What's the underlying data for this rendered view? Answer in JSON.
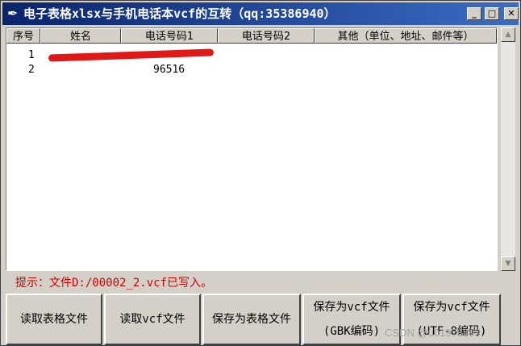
{
  "window": {
    "title": "电子表格xlsx与手机电话本vcf的互转（qq:35386940）",
    "controls": {
      "minimize": "_",
      "maximize": "□",
      "close": "✕"
    }
  },
  "table": {
    "columns": [
      "序号",
      "姓名",
      "电话号码1",
      "电话号码2",
      "其他（单位、地址、邮件等）"
    ],
    "rows": [
      {
        "index": "1",
        "name": "",
        "phone1": "",
        "phone2": "",
        "other": ""
      },
      {
        "index": "2",
        "name": "",
        "phone1": "96516",
        "phone2": "",
        "other": ""
      }
    ]
  },
  "status": {
    "message": "提示：文件D:/00002_2.vcf已写入。"
  },
  "buttons": {
    "read_table": "读取表格文件",
    "read_vcf": "读取vcf文件",
    "save_table": "保存为表格文件",
    "save_vcf_gbk_line1": "保存为vcf文件",
    "save_vcf_gbk_line2": "(GBK编码)",
    "save_vcf_utf8_line1": "保存为vcf文件",
    "save_vcf_utf8_line2": "(UTF-8编码)"
  },
  "watermark": "CSDN @u01978899",
  "icons": {
    "app": "feather-icon",
    "scroll_up": "arrow-up-icon",
    "scroll_down": "arrow-down-icon"
  },
  "colors": {
    "titlebar": "#0a246a",
    "status_text": "#d00000",
    "redaction": "#e01818"
  }
}
